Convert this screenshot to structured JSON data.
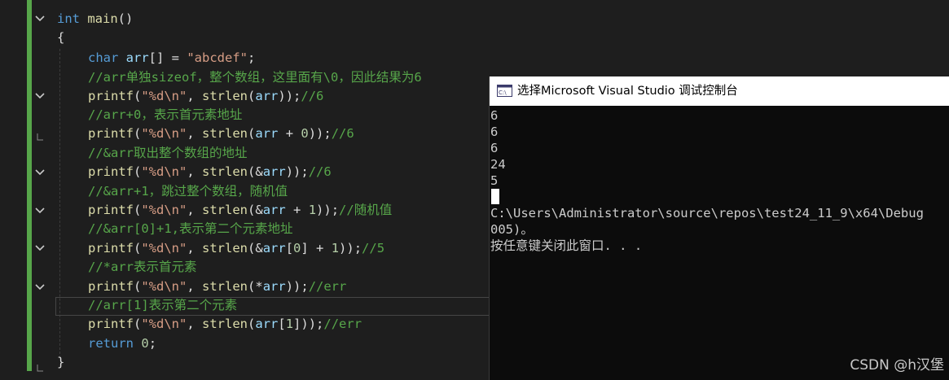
{
  "editor": {
    "lines": [
      {
        "kind": "main",
        "parts": [
          [
            "kw",
            "int"
          ],
          [
            "plain",
            " "
          ],
          [
            "fn",
            "main"
          ],
          [
            "plain",
            "()"
          ]
        ]
      },
      {
        "kind": "brace",
        "parts": [
          [
            "plain",
            "{"
          ]
        ]
      },
      {
        "kind": "code",
        "parts": [
          [
            "kw",
            "char"
          ],
          [
            "plain",
            " "
          ],
          [
            "var",
            "arr"
          ],
          [
            "plain",
            "[] = "
          ],
          [
            "str",
            "\"abcdef\""
          ],
          [
            "plain",
            ";"
          ]
        ]
      },
      {
        "kind": "comment",
        "parts": [
          [
            "cm",
            "//arr单独sizeof，整个数组，这里面有\\0，因此结果为6"
          ]
        ]
      },
      {
        "kind": "code",
        "parts": [
          [
            "fn",
            "printf"
          ],
          [
            "plain",
            "("
          ],
          [
            "str",
            "\"%d\\n\""
          ],
          [
            "plain",
            ", "
          ],
          [
            "fn",
            "strlen"
          ],
          [
            "plain",
            "("
          ],
          [
            "var",
            "arr"
          ],
          [
            "plain",
            "));"
          ],
          [
            "cm",
            "//6"
          ]
        ]
      },
      {
        "kind": "comment",
        "parts": [
          [
            "cm",
            "//arr+0，表示首元素地址"
          ]
        ]
      },
      {
        "kind": "code",
        "parts": [
          [
            "fn",
            "printf"
          ],
          [
            "plain",
            "("
          ],
          [
            "str",
            "\"%d\\n\""
          ],
          [
            "plain",
            ", "
          ],
          [
            "fn",
            "strlen"
          ],
          [
            "plain",
            "("
          ],
          [
            "var",
            "arr"
          ],
          [
            "plain",
            " + "
          ],
          [
            "num",
            "0"
          ],
          [
            "plain",
            "));"
          ],
          [
            "cm",
            "//6"
          ]
        ]
      },
      {
        "kind": "comment",
        "parts": [
          [
            "cm",
            "//&arr取出整个数组的地址"
          ]
        ]
      },
      {
        "kind": "code",
        "parts": [
          [
            "fn",
            "printf"
          ],
          [
            "plain",
            "("
          ],
          [
            "str",
            "\"%d\\n\""
          ],
          [
            "plain",
            ", "
          ],
          [
            "fn",
            "strlen"
          ],
          [
            "plain",
            "(&"
          ],
          [
            "var",
            "arr"
          ],
          [
            "plain",
            "));"
          ],
          [
            "cm",
            "//6"
          ]
        ]
      },
      {
        "kind": "comment",
        "parts": [
          [
            "cm",
            "//&arr+1，跳过整个数组，随机值"
          ]
        ]
      },
      {
        "kind": "code",
        "parts": [
          [
            "fn",
            "printf"
          ],
          [
            "plain",
            "("
          ],
          [
            "str",
            "\"%d\\n\""
          ],
          [
            "plain",
            ", "
          ],
          [
            "fn",
            "strlen"
          ],
          [
            "plain",
            "(&"
          ],
          [
            "var",
            "arr"
          ],
          [
            "plain",
            " + "
          ],
          [
            "num",
            "1"
          ],
          [
            "plain",
            "));"
          ],
          [
            "cm",
            "//随机值"
          ]
        ]
      },
      {
        "kind": "comment",
        "parts": [
          [
            "cm",
            "//&arr[0]+1,表示第二个元素地址"
          ]
        ]
      },
      {
        "kind": "code",
        "parts": [
          [
            "fn",
            "printf"
          ],
          [
            "plain",
            "("
          ],
          [
            "str",
            "\"%d\\n\""
          ],
          [
            "plain",
            ", "
          ],
          [
            "fn",
            "strlen"
          ],
          [
            "plain",
            "(&"
          ],
          [
            "var",
            "arr"
          ],
          [
            "plain",
            "["
          ],
          [
            "num",
            "0"
          ],
          [
            "plain",
            "] + "
          ],
          [
            "num",
            "1"
          ],
          [
            "plain",
            "));"
          ],
          [
            "cm",
            "//5"
          ]
        ]
      },
      {
        "kind": "comment",
        "parts": [
          [
            "cm",
            "//*arr表示首元素"
          ]
        ]
      },
      {
        "kind": "code",
        "parts": [
          [
            "fn",
            "printf"
          ],
          [
            "plain",
            "("
          ],
          [
            "str",
            "\"%d\\n\""
          ],
          [
            "plain",
            ", "
          ],
          [
            "fn",
            "strlen"
          ],
          [
            "plain",
            "(*"
          ],
          [
            "var",
            "arr"
          ],
          [
            "plain",
            "));"
          ],
          [
            "cm",
            "//err"
          ]
        ]
      },
      {
        "kind": "comment",
        "parts": [
          [
            "cm",
            "//arr[1]表示第二个元素"
          ]
        ]
      },
      {
        "kind": "code",
        "parts": [
          [
            "fn",
            "printf"
          ],
          [
            "plain",
            "("
          ],
          [
            "str",
            "\"%d\\n\""
          ],
          [
            "plain",
            ", "
          ],
          [
            "fn",
            "strlen"
          ],
          [
            "plain",
            "("
          ],
          [
            "var",
            "arr"
          ],
          [
            "plain",
            "["
          ],
          [
            "num",
            "1"
          ],
          [
            "plain",
            "]));"
          ],
          [
            "cm",
            "//err"
          ]
        ]
      },
      {
        "kind": "code",
        "parts": [
          [
            "kw",
            "return"
          ],
          [
            "plain",
            " "
          ],
          [
            "num",
            "0"
          ],
          [
            "plain",
            ";"
          ]
        ]
      },
      {
        "kind": "brace",
        "parts": [
          [
            "plain",
            "}"
          ]
        ]
      }
    ]
  },
  "console": {
    "title": "选择Microsoft Visual Studio 调试控制台",
    "output": [
      "6",
      "6",
      "6",
      "24",
      "5"
    ],
    "exit_line_1": "C:\\Users\\Administrator\\source\\repos\\test24_11_9\\x64\\Debug",
    "exit_line_2": "005)。",
    "press_key": "按任意键关闭此窗口. . ."
  },
  "watermark": "CSDN @h汉堡",
  "colors": {
    "background": "#1e1e1e",
    "keyword": "#569cd6",
    "function": "#dcdcaa",
    "string": "#d69d85",
    "comment": "#57a64a",
    "number": "#b5cea8",
    "variable": "#9cdcfe",
    "change_bar": "#57a64a"
  }
}
